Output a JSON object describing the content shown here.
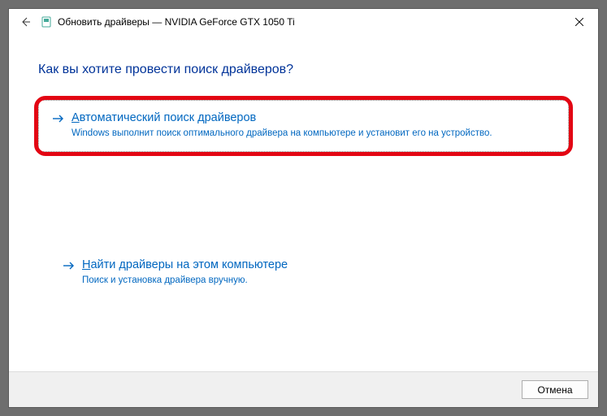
{
  "titlebar": {
    "back_label": "Back",
    "title": "Обновить драйверы — NVIDIA GeForce GTX 1050 Ti",
    "close_label": "Close"
  },
  "heading": "Как вы хотите провести поиск драйверов?",
  "options": [
    {
      "title_prefix": "А",
      "title_rest": "втоматический поиск драйверов",
      "description": "Windows выполнит поиск оптимального драйвера на компьютере и установит его на устройство."
    },
    {
      "title_prefix": "Н",
      "title_rest": "айти драйверы на этом компьютере",
      "description": "Поиск и установка драйвера вручную."
    }
  ],
  "footer": {
    "cancel": "Отмена"
  }
}
